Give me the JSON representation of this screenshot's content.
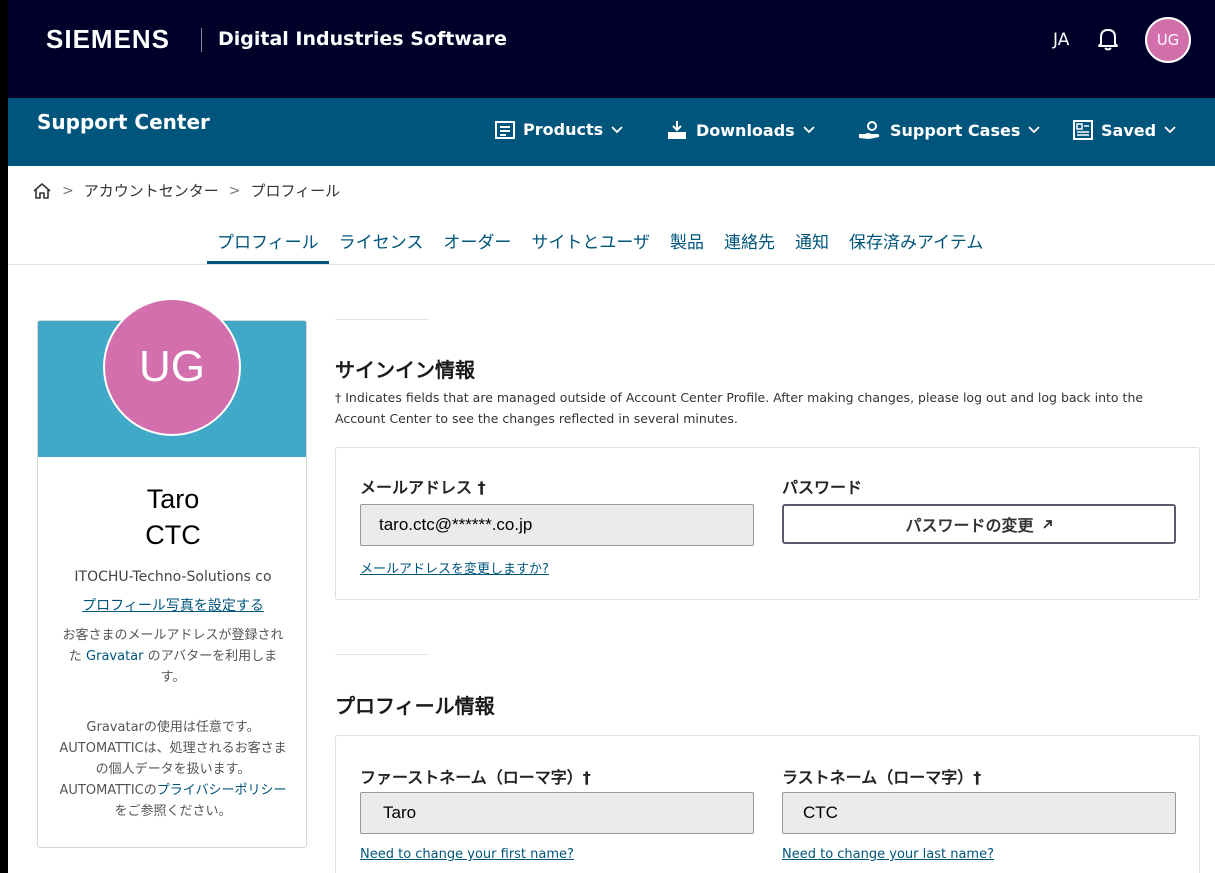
{
  "header": {
    "brand": "SIEMENS",
    "brand_sub": "Digital Industries Software",
    "language": "JA",
    "user_initials": "UG"
  },
  "support_bar": {
    "title": "Support Center",
    "nav": {
      "products": "Products",
      "downloads": "Downloads",
      "support_cases": "Support Cases",
      "saved": "Saved"
    }
  },
  "breadcrumb": {
    "account_center": "アカウントセンター",
    "profile": "プロフィール"
  },
  "tabs": {
    "profile": "プロフィール",
    "license": "ライセンス",
    "orders": "オーダー",
    "sites_users": "サイトとユーザ",
    "products": "製品",
    "contacts": "連絡先",
    "notifications": "通知",
    "saved_items": "保存済みアイテム"
  },
  "profile_card": {
    "initials": "UG",
    "first_name": "Taro",
    "last_name": "CTC",
    "company": "ITOCHU-Techno-Solutions co",
    "set_photo_link": "プロフィール写真を設定する",
    "gravatar_text_1": "お客さまのメールアドレスが登録された",
    "gravatar_link": "Gravatar",
    "gravatar_text_2": "のアバターを利用します。",
    "privacy_text_1": "Gravatarの使用は任意です。AUTOMATTICは、処理されるお客さまの個人データを扱います。AUTOMATTICの",
    "privacy_link": "プライバシーポリシー",
    "privacy_text_2": "をご参照ください。"
  },
  "signin": {
    "title": "サインイン情報",
    "note": "† Indicates fields that are managed outside of Account Center Profile. After making changes, please log out and log back into the Account Center to see the changes reflected in several minutes.",
    "email_label": "メールアドレス †",
    "email_value": "taro.ctc@******.co.jp",
    "email_change_link": "メールアドレスを変更しますか?",
    "password_label": "パスワード",
    "password_button": "パスワードの変更"
  },
  "profile_info": {
    "title": "プロフィール情報",
    "first_name_label": "ファーストネーム（ローマ字）†",
    "first_name_value": "Taro",
    "first_name_link": "Need to change your first name?",
    "last_name_label": "ラストネーム（ローマ字）†",
    "last_name_value": "CTC",
    "last_name_link": "Need to change your last name?"
  },
  "colors": {
    "top_bar": "#000028",
    "support_bar": "#00557c",
    "accent": "#00557c",
    "card_banner": "#3fa9c7",
    "avatar": "#d36fad"
  }
}
